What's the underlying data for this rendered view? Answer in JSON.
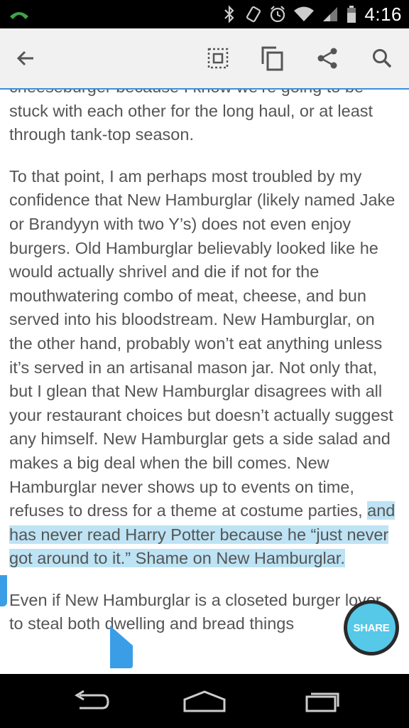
{
  "status_bar": {
    "time": "4:16",
    "icons": [
      "phone-call-icon",
      "bluetooth-icon",
      "vibrate-icon",
      "alarm-icon",
      "wifi-icon",
      "signal-icon",
      "battery-icon"
    ]
  },
  "app_bar": {
    "icons": [
      "back-arrow-icon",
      "select-all-icon",
      "copy-icon",
      "share-icon",
      "search-icon"
    ]
  },
  "article": {
    "paragraph_1": "cheeseburger because I know we’re going to be stuck with each other for the long haul, or at least through tank-top season.",
    "paragraph_2_before": "To that point, I am perhaps most troubled by my confidence that New Hamburglar (likely named Jake or Brandyyn with two Y’s) does not even enjoy burgers. Old Hamburglar believably looked like he would actually shrivel and die if not for the mouthwatering combo of meat, cheese, and bun served into his bloodstream. New Hamburglar, on the other hand, probably won’t eat anything unless it’s served in an artisanal mason jar. Not only that, but I glean that New Hamburglar disagrees with all your restaurant choices but doesn’t actually suggest any himself. New Hamburglar gets a side salad and makes a big deal when the bill comes. New Hamburglar never shows up to events on time, refuses to dress for a theme at costume parties, ",
    "paragraph_2_selected": "and has never read Harry Potter because he “just never got around to it.” Shame on New Hamburglar.",
    "paragraph_3": "Even if New Hamburglar is a closeted burger lover, to steal both dwelling and bread things"
  },
  "share_button": {
    "label": "SHARE"
  },
  "nav_bar": {
    "icons": [
      "back-nav-icon",
      "home-nav-icon",
      "recents-nav-icon"
    ]
  },
  "colors": {
    "accent": "#3b8fd9",
    "selection": "#bde3f4",
    "handle": "#3a9ee6",
    "fab": "#56c8e8",
    "text": "#555555"
  }
}
